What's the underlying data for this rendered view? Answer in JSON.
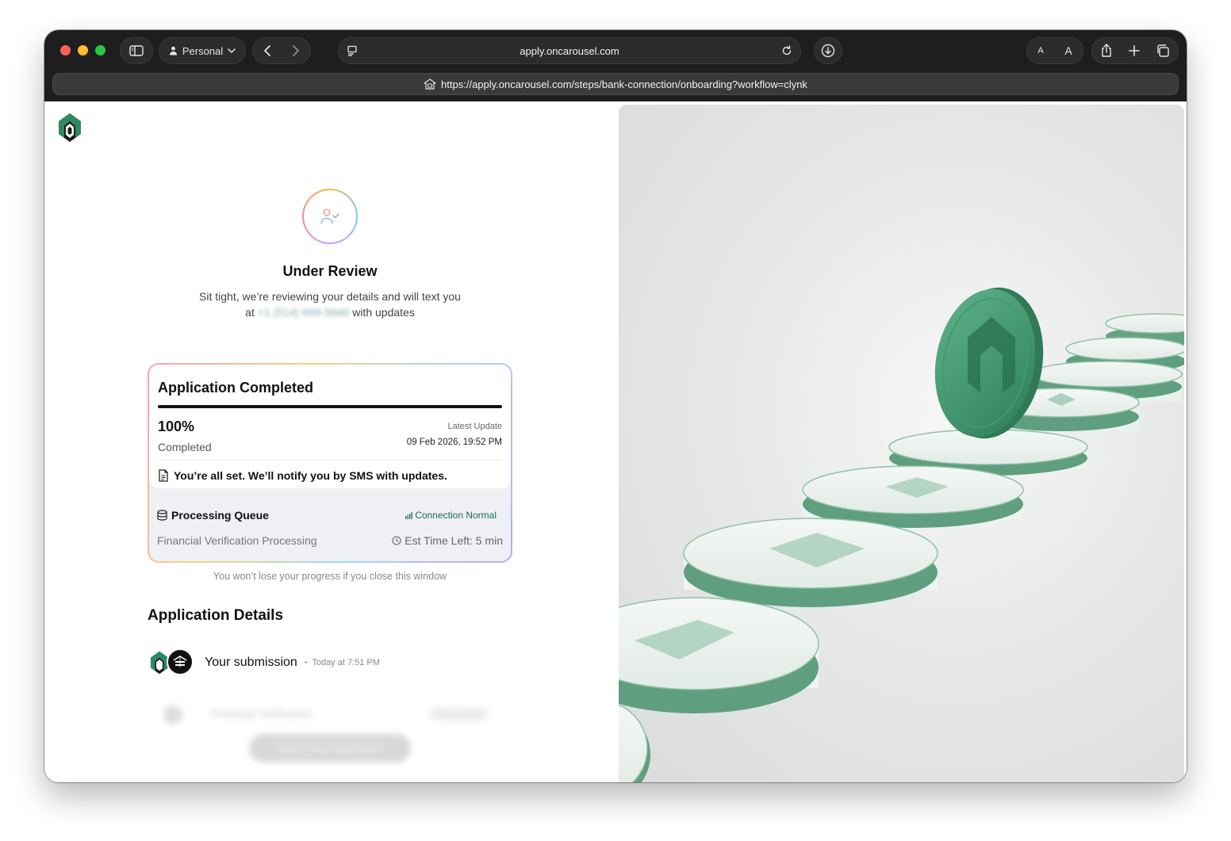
{
  "browser": {
    "profile_label": "Personal",
    "tab_url": "apply.oncarousel.com",
    "full_url": "https://apply.oncarousel.com/steps/bank-connection/onboarding?workflow=clynk",
    "font_small_label": "A",
    "font_large_label": "A"
  },
  "status": {
    "title": "Under Review",
    "subtitle_part1": "Sit tight, we’re reviewing your details and will text you",
    "subtitle_at": "at",
    "phone_blurred": "+1 (514) 699-5840",
    "subtitle_part2": "with updates"
  },
  "card": {
    "title": "Application Completed",
    "progress_percent": 100,
    "percent_label": "100%",
    "completed_label": "Completed",
    "latest_update_label": "Latest Update",
    "latest_update_value": "09 Feb 2026, 19:52 PM",
    "notify_message": "You’re all set. We’ll notify you by SMS with updates.",
    "queue_label": "Processing Queue",
    "connection_status": "Connection Normal",
    "processing_stage": "Financial Verification Processing",
    "est_time": "Est Time Left: 5 min"
  },
  "progress_note": "You won’t lose your progress if you close this window",
  "details": {
    "heading": "Application Details",
    "submission_title": "Your submission",
    "submission_time": "Today at 7:51 PM",
    "blurred_item_title": "Financial Verification",
    "blurred_item_badge": "Processing",
    "blurred_button_label": "Start A New Application"
  },
  "colors": {
    "brand_green": "#2e8a63",
    "dark": "#111111",
    "connection_green": "#1f6b4f"
  },
  "icons": {
    "logo": "carousel-logo-icon",
    "avatar": "user-check-icon",
    "document": "document-icon",
    "queue": "database-icon",
    "signal": "signal-bars-icon",
    "clock": "clock-icon"
  }
}
